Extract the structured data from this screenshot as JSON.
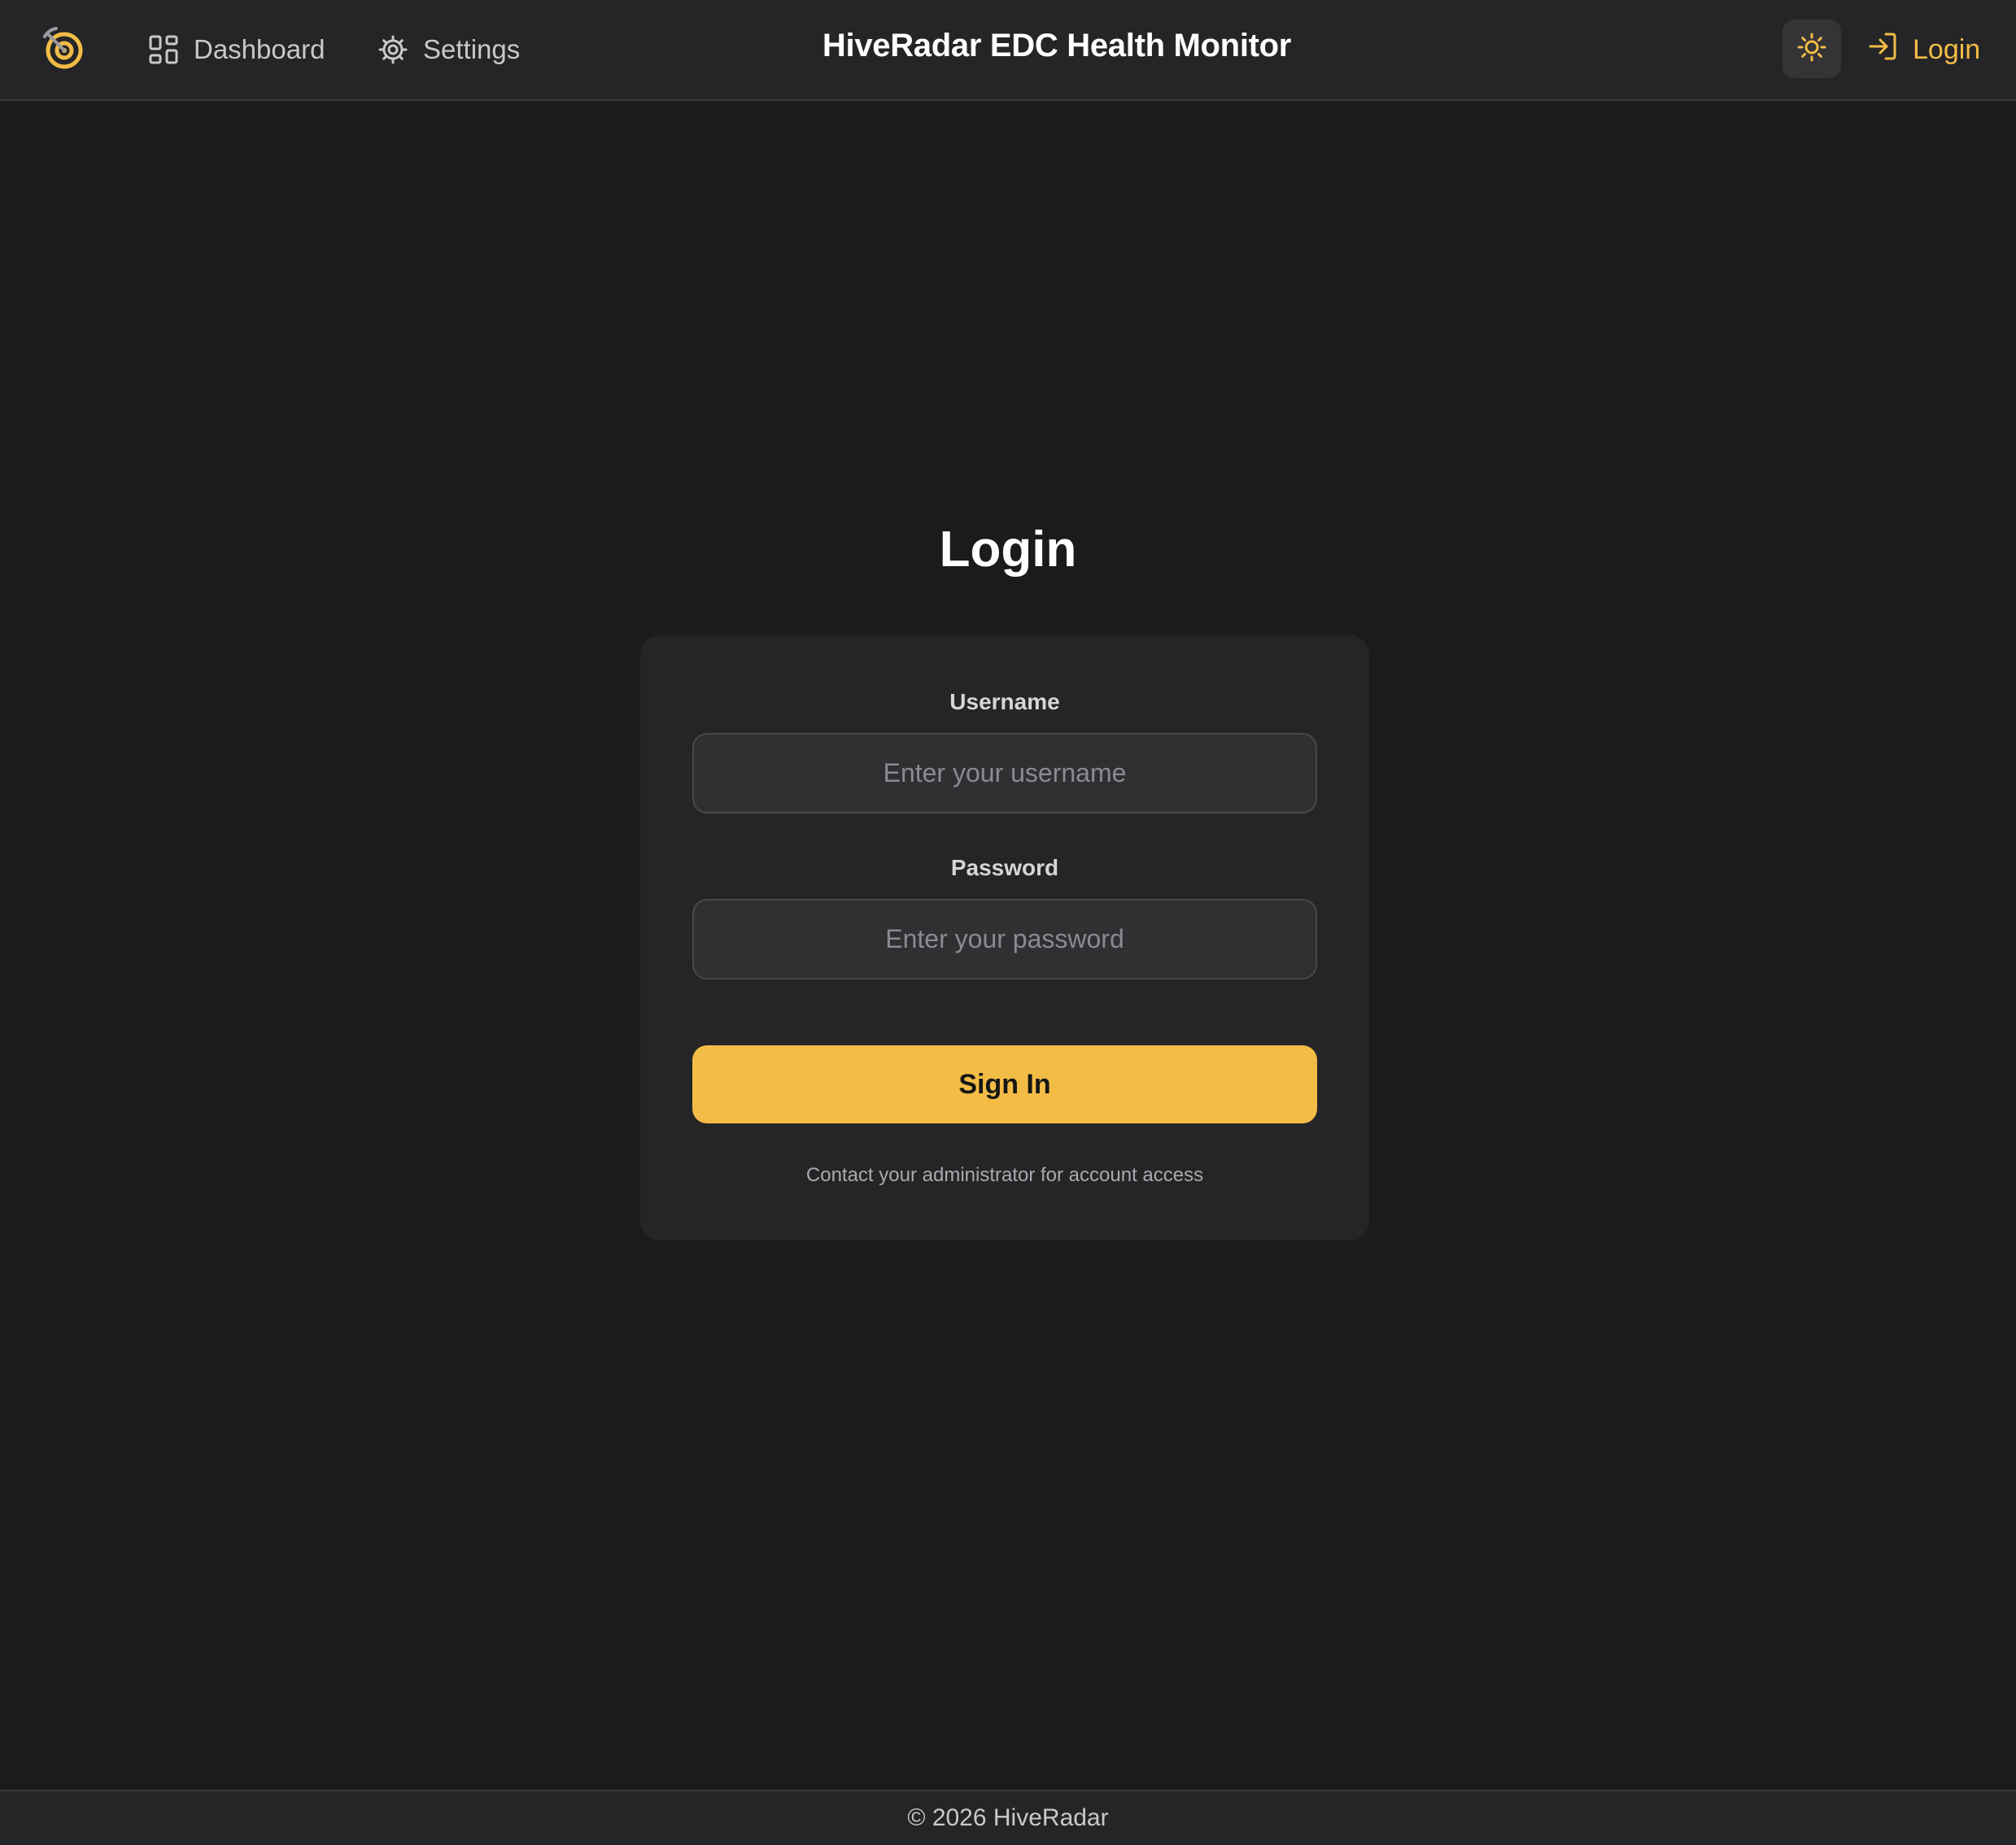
{
  "header": {
    "logo_icon": "radar-logo-icon",
    "nav": [
      {
        "label": "Dashboard",
        "icon": "grid-icon"
      },
      {
        "label": "Settings",
        "icon": "gear-icon"
      }
    ],
    "title": "HiveRadar EDC Health Monitor",
    "theme_toggle_icon": "sun-icon",
    "login_label": "Login",
    "login_icon": "log-in-icon"
  },
  "login": {
    "title": "Login",
    "username_label": "Username",
    "username_placeholder": "Enter your username",
    "username_value": "",
    "password_label": "Password",
    "password_placeholder": "Enter your password",
    "password_value": "",
    "submit_label": "Sign In",
    "help_text": "Contact your administrator for account access"
  },
  "footer": {
    "text": "© 2026 HiveRadar"
  },
  "colors": {
    "background": "#1b1b1c",
    "surface": "#252527",
    "accent": "#f2bc46",
    "text": "#ffffff",
    "muted": "#c9c9cc"
  }
}
